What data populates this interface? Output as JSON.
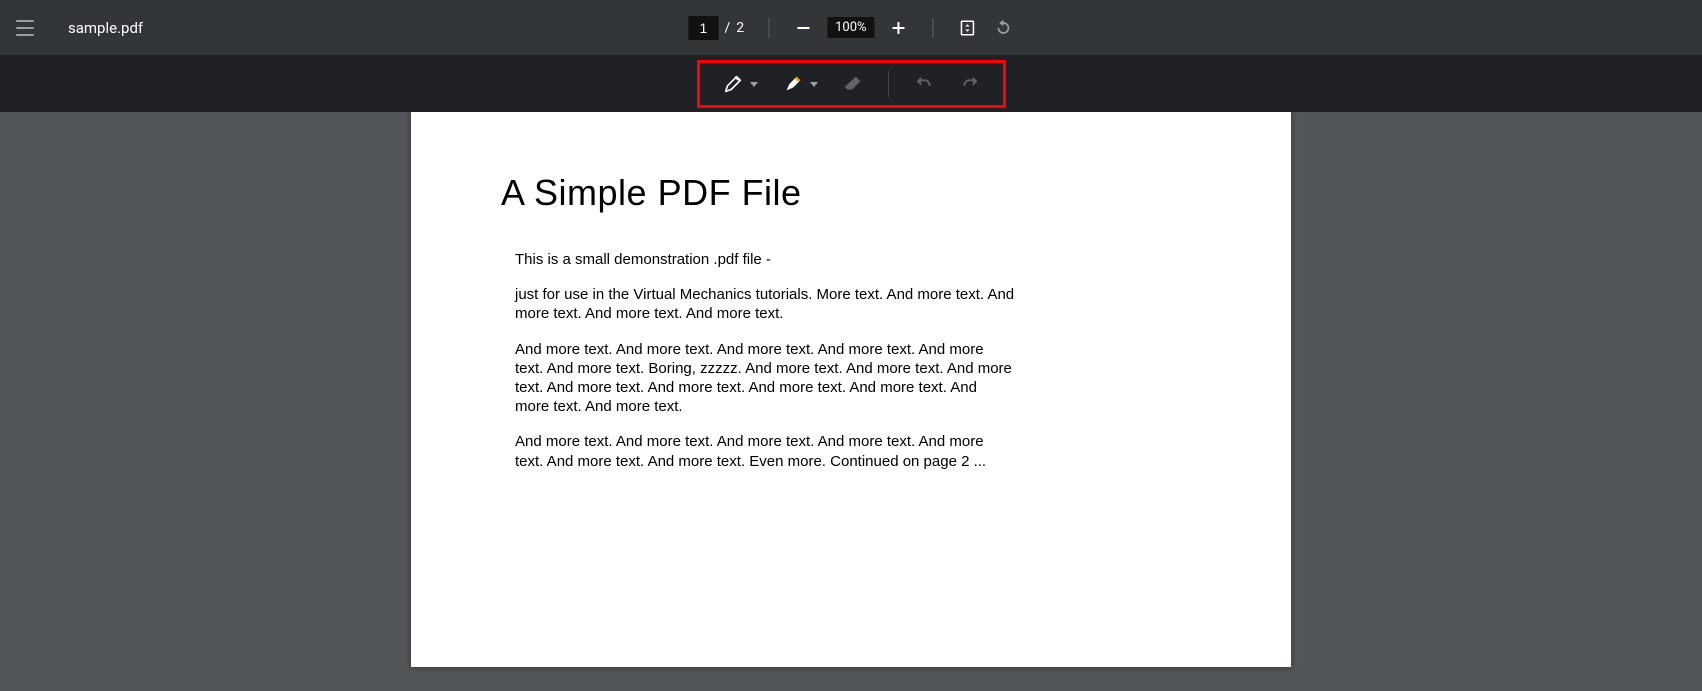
{
  "header": {
    "filename": "sample.pdf",
    "current_page": "1",
    "page_sep": "/",
    "total_pages": "2",
    "zoom_level": "100%"
  },
  "document": {
    "title": "A Simple PDF File",
    "p1": "This is a small demonstration .pdf file -",
    "p2": "just for use in the Virtual Mechanics tutorials. More text. And more text. And more text. And more text. And more text.",
    "p3": "And more text. And more text. And more text. And more text. And more text. And more text. Boring, zzzzz. And more text. And more text. And more text. And more text. And more text. And more text. And more text. And more text. And more text.",
    "p4": "And more text. And more text. And more text. And more text. And more text. And more text. And more text. Even more. Continued on page 2 ..."
  }
}
